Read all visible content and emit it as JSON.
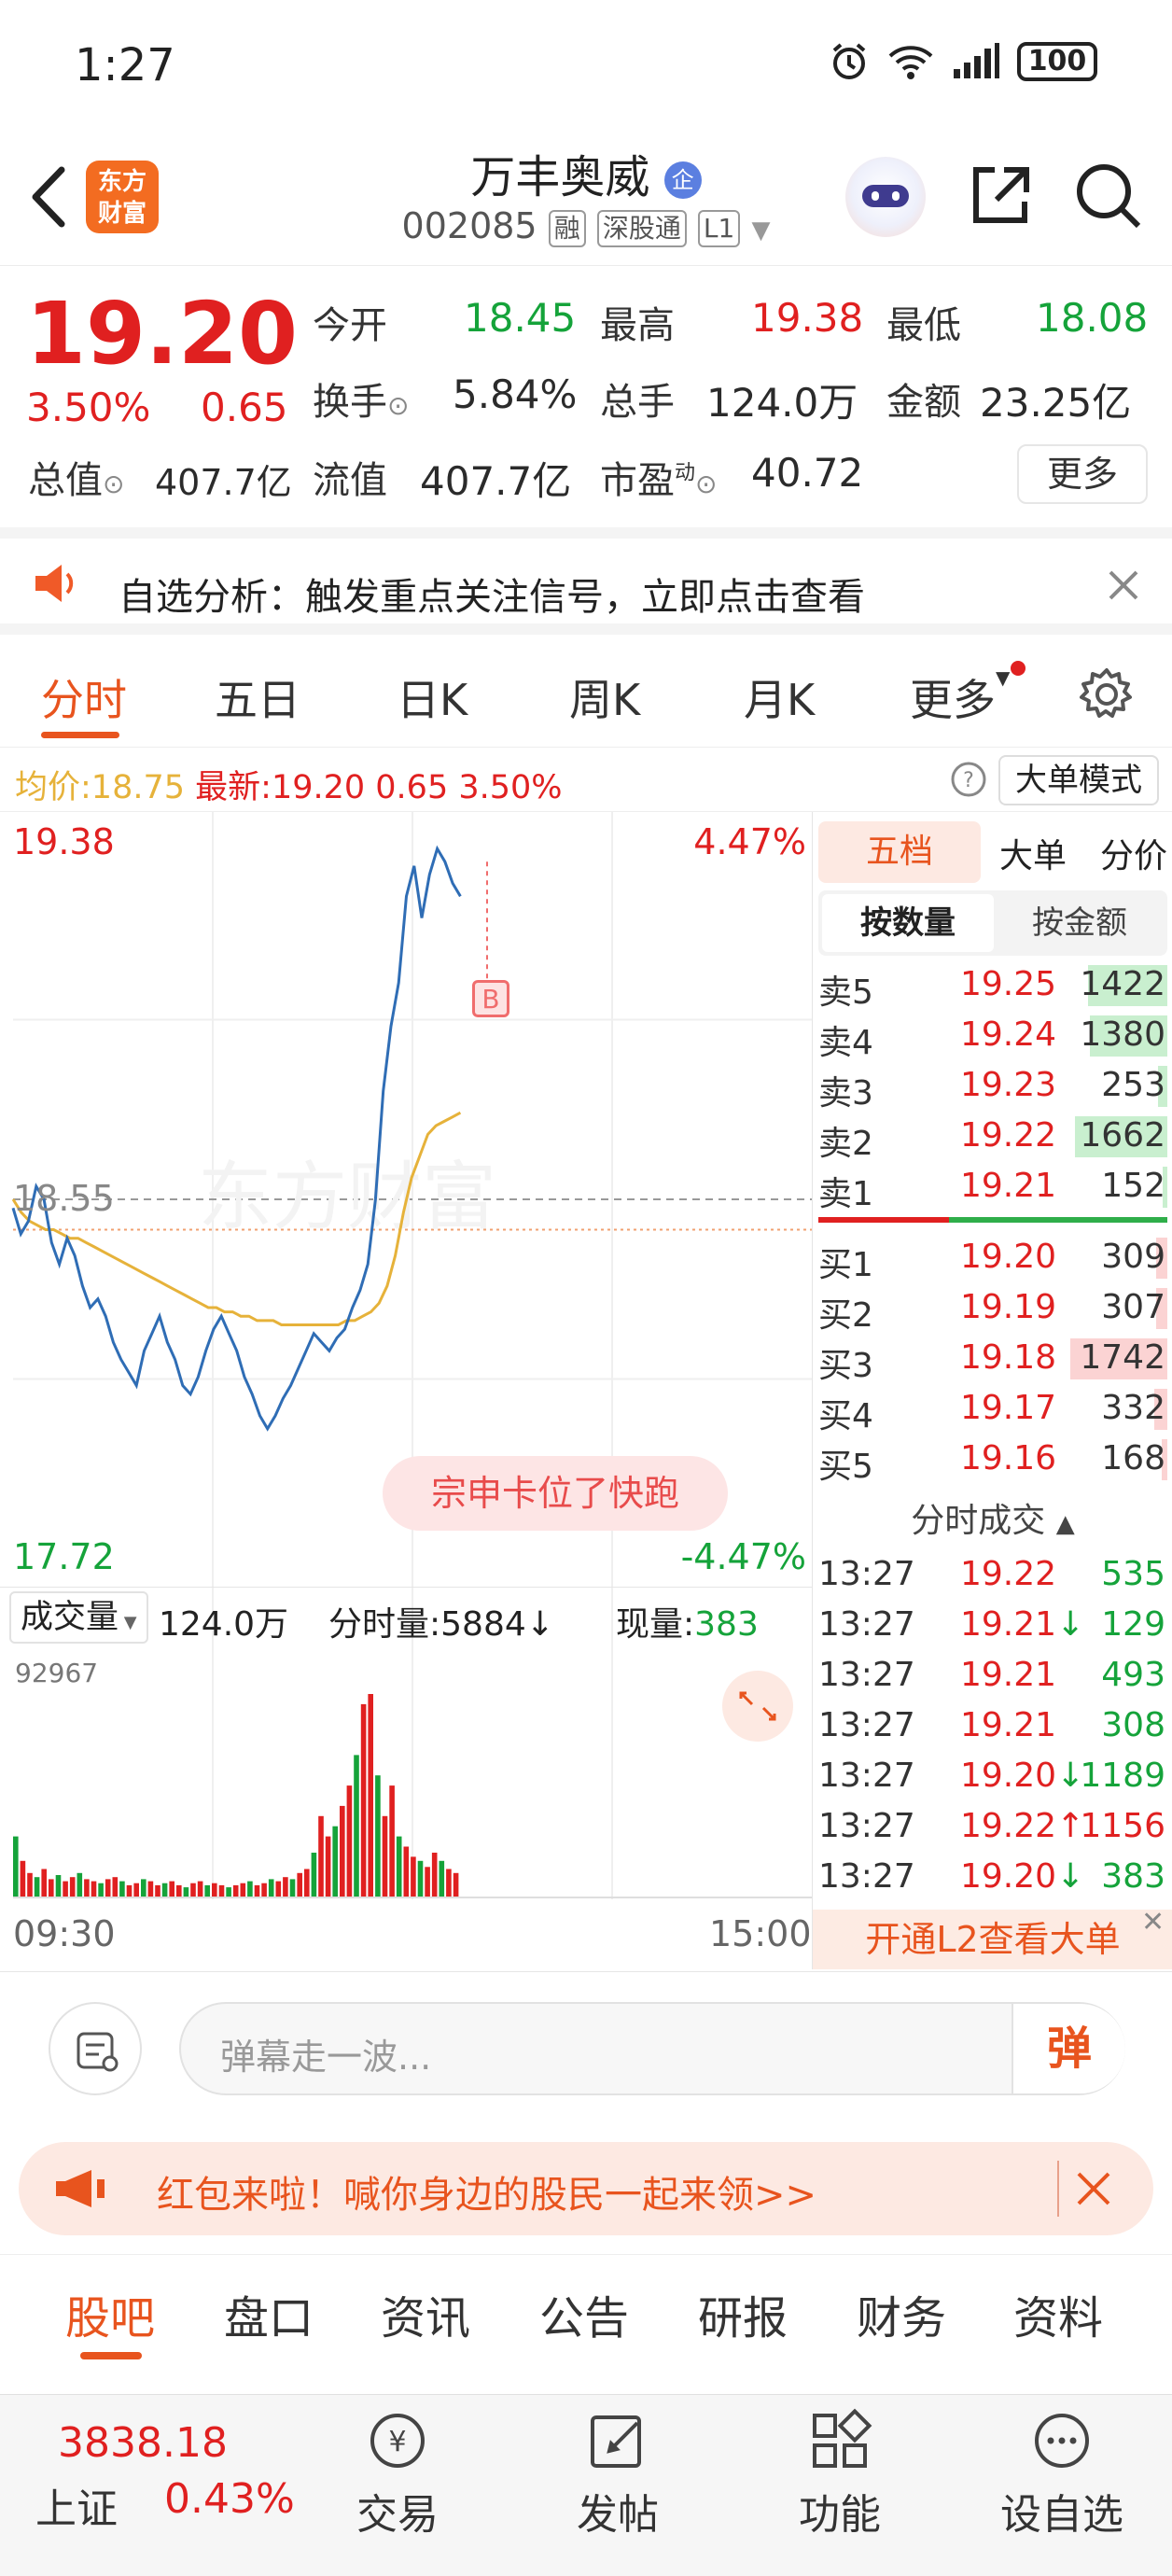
{
  "status_bar": {
    "time": "1:27",
    "battery": "100"
  },
  "header": {
    "logo_text": [
      "东方",
      "财富"
    ],
    "stock_name": "万丰奥威",
    "name_badge": "企",
    "stock_code": "002085",
    "tags": [
      "融",
      "深股通",
      "L1"
    ]
  },
  "quote": {
    "price": "19.20",
    "change_pct": "3.50%",
    "change_amt": "0.65",
    "open_label": "今开",
    "open": "18.45",
    "high_label": "最高",
    "high": "19.38",
    "low_label": "最低",
    "low": "18.08",
    "turnover_rate_label": "换手",
    "turnover_rate": "5.84%",
    "volume_label": "总手",
    "volume": "124.0万",
    "amount_label": "金额",
    "amount": "23.25亿",
    "mktcap_label": "总值",
    "mktcap": "407.7亿",
    "float_cap_label": "流值",
    "float_cap": "407.7亿",
    "pe_label": "市盈",
    "pe_sup": "动",
    "pe": "40.72",
    "more_label": "更多"
  },
  "notice": {
    "text": "自选分析：触发重点关注信号，立即点击查看"
  },
  "chart_tabs": {
    "items": [
      "分时",
      "五日",
      "日K",
      "周K",
      "月K",
      "更多"
    ],
    "active": "分时"
  },
  "avg_row": {
    "avg_label": "均价:",
    "avg": "18.75",
    "latest_label": "最新:",
    "latest": "19.20",
    "change": "0.65",
    "pct": "3.50%",
    "mode_button": "大单模式"
  },
  "intraday": {
    "y_top": "19.38",
    "y_mid": "18.55",
    "y_bottom": "17.72",
    "pct_top": "4.47%",
    "pct_bottom": "-4.47%",
    "watermark": "东方财富",
    "signal": "B",
    "bubble": "宗申卡位了快跑",
    "volume_label": "成交量",
    "volume_total": "124.0万",
    "tick_vol_label": "分时量:",
    "tick_vol": "5884",
    "cur_vol_label": "现量:",
    "cur_vol": "383",
    "vol_max": "92967",
    "time_start": "09:30",
    "time_end": "15:00"
  },
  "chart_data": {
    "type": "line",
    "x_start": "09:30",
    "x_end": "15:00",
    "ylim": [
      17.72,
      19.38
    ],
    "base": 18.55,
    "series": [
      {
        "name": "价格",
        "values": [
          18.53,
          18.47,
          18.5,
          18.58,
          18.55,
          18.45,
          18.4,
          18.46,
          18.42,
          18.35,
          18.3,
          18.32,
          18.28,
          18.22,
          18.18,
          18.15,
          18.12,
          18.2,
          18.24,
          18.28,
          18.22,
          18.18,
          18.12,
          18.1,
          18.14,
          18.2,
          18.25,
          18.28,
          18.24,
          18.2,
          18.14,
          18.1,
          18.05,
          18.02,
          18.05,
          18.09,
          18.12,
          18.16,
          18.2,
          18.24,
          18.22,
          18.2,
          18.23,
          18.25,
          18.3,
          18.34,
          18.4,
          18.55,
          18.8,
          18.95,
          19.05,
          19.25,
          19.32,
          19.2,
          19.3,
          19.36,
          19.33,
          19.28,
          19.25
        ]
      },
      {
        "name": "均价",
        "values": [
          18.55,
          18.52,
          18.5,
          18.49,
          18.48,
          18.48,
          18.47,
          18.46,
          18.46,
          18.45,
          18.44,
          18.43,
          18.42,
          18.41,
          18.4,
          18.39,
          18.38,
          18.37,
          18.36,
          18.35,
          18.34,
          18.33,
          18.32,
          18.31,
          18.3,
          18.3,
          18.29,
          18.29,
          18.28,
          18.28,
          18.27,
          18.27,
          18.27,
          18.26,
          18.26,
          18.26,
          18.26,
          18.26,
          18.26,
          18.26,
          18.26,
          18.27,
          18.27,
          18.28,
          18.29,
          18.31,
          18.35,
          18.42,
          18.52,
          18.6,
          18.65,
          18.7,
          18.72,
          18.73,
          18.74,
          18.75
        ]
      }
    ],
    "volume_bars": [
      30,
      18,
      12,
      10,
      14,
      9,
      11,
      8,
      10,
      12,
      9,
      8,
      7,
      9,
      10,
      8,
      6,
      7,
      9,
      8,
      6,
      7,
      8,
      6,
      5,
      7,
      8,
      6,
      7,
      6,
      5,
      6,
      7,
      8,
      6,
      7,
      9,
      8,
      10,
      9,
      12,
      14,
      22,
      40,
      30,
      35,
      45,
      55,
      70,
      95,
      100,
      60,
      40,
      55,
      30,
      25,
      20,
      18,
      15,
      22,
      18,
      14,
      12
    ]
  },
  "orderbook": {
    "tabs": [
      "五档",
      "大单",
      "分价"
    ],
    "subtabs": [
      "按数量",
      "按金额"
    ],
    "asks": [
      {
        "label": "卖5",
        "price": "19.25",
        "qty": "1422",
        "bar": 0.82
      },
      {
        "label": "卖4",
        "price": "19.24",
        "qty": "1380",
        "bar": 0.8
      },
      {
        "label": "卖3",
        "price": "19.23",
        "qty": "253",
        "bar": 0.1
      },
      {
        "label": "卖2",
        "price": "19.22",
        "qty": "1662",
        "bar": 0.95
      },
      {
        "label": "卖1",
        "price": "19.21",
        "qty": "152",
        "bar": 0.05
      }
    ],
    "bids": [
      {
        "label": "买1",
        "price": "19.20",
        "qty": "309",
        "bar": 0.12
      },
      {
        "label": "买2",
        "price": "19.19",
        "qty": "307",
        "bar": 0.12
      },
      {
        "label": "买3",
        "price": "19.18",
        "qty": "1742",
        "bar": 1.0
      },
      {
        "label": "买4",
        "price": "19.17",
        "qty": "332",
        "bar": 0.13
      },
      {
        "label": "买5",
        "price": "19.16",
        "qty": "168",
        "bar": 0.06
      }
    ],
    "trades_title": "分时成交",
    "trades": [
      {
        "time": "13:27",
        "price": "19.22",
        "arrow": "",
        "qty": "535",
        "color": "#15a33a"
      },
      {
        "time": "13:27",
        "price": "19.21",
        "arrow": "↓",
        "qty": "129",
        "color": "#15a33a"
      },
      {
        "time": "13:27",
        "price": "19.21",
        "arrow": "",
        "qty": "493",
        "color": "#15a33a"
      },
      {
        "time": "13:27",
        "price": "19.21",
        "arrow": "",
        "qty": "308",
        "color": "#15a33a"
      },
      {
        "time": "13:27",
        "price": "19.20",
        "arrow": "↓",
        "qty": "1189",
        "color": "#15a33a"
      },
      {
        "time": "13:27",
        "price": "19.22",
        "arrow": "↑",
        "qty": "1156",
        "color": "#e02020"
      },
      {
        "time": "13:27",
        "price": "19.20",
        "arrow": "↓",
        "qty": "383",
        "color": "#15a33a"
      }
    ],
    "l2_text": "开通L2查看大单"
  },
  "danmu": {
    "placeholder": "弹幕走一波...",
    "send_label": "弹"
  },
  "redpack": {
    "text": "红包来啦！喊你身边的股民一起来领>>"
  },
  "bottom_tabs": {
    "items": [
      "股吧",
      "盘口",
      "资讯",
      "公告",
      "研报",
      "财务",
      "资料"
    ],
    "active": "股吧"
  },
  "bottom_nav": {
    "index_value": "3838.18",
    "index_name": "上证",
    "index_pct": "0.43%",
    "items": [
      "交易",
      "发帖",
      "功能",
      "设自选"
    ]
  },
  "colors": {
    "up": "#e02020",
    "down": "#15a33a",
    "accent": "#e8541e",
    "price_line": "#2f6db5",
    "avg_line": "#e6b23a"
  }
}
